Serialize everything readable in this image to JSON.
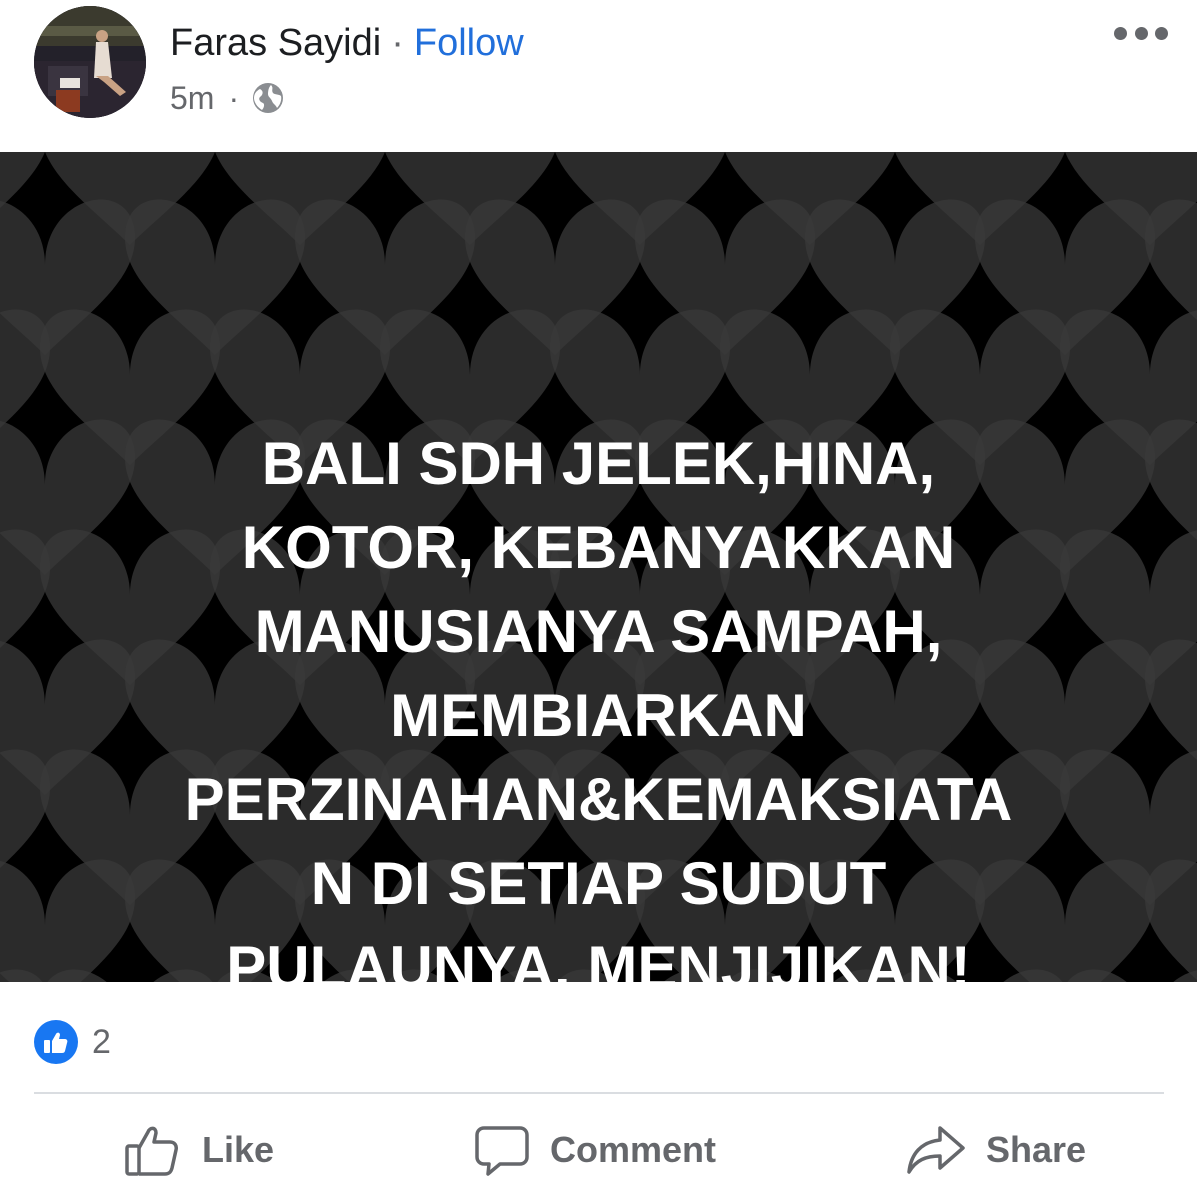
{
  "post": {
    "author": "Faras Sayidi",
    "separator": "·",
    "follow_label": "Follow",
    "time": "5m",
    "meta_separator": "·",
    "privacy_icon": "globe-icon",
    "more_icon": "more-options-icon",
    "image_text_lines": [
      "BALI SDH JELEK,HINA,",
      "KOTOR, KEBANYAKKAN",
      "MANUSIANYA SAMPAH,",
      "MEMBIARKAN",
      "PERZINAHAN&KEMAKSIATA",
      "N DI SETIAP SUDUT",
      "PULAUNYA. MENJIJIKAN!"
    ],
    "image_background": {
      "base_color": "#000000",
      "pattern_color": "#3a3a3a",
      "pattern_icon": "heart-pattern"
    },
    "reaction_icon": "like-reaction-icon",
    "reaction_count": "2"
  },
  "actions": {
    "like_label": "Like",
    "comment_label": "Comment",
    "share_label": "Share"
  },
  "colors": {
    "accent": "#216fdb",
    "secondary_text": "#65676b",
    "like_blue": "#1877f2"
  }
}
